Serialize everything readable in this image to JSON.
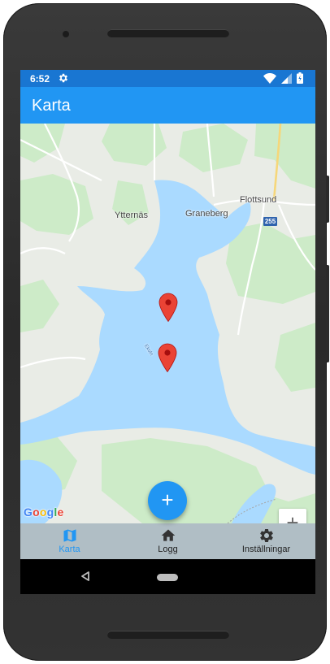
{
  "status_bar": {
    "time": "6:52",
    "icons": [
      "settings-icon",
      "wifi-icon",
      "signal-icon",
      "battery-icon"
    ]
  },
  "app_bar": {
    "title": "Karta"
  },
  "map": {
    "labels": [
      "Ytternäs",
      "Graneberg",
      "Flottsund"
    ],
    "road_shield": "255",
    "lake_label": "Ekoln",
    "attribution": "Google",
    "markers": [
      "location-pin-1",
      "location-pin-2"
    ],
    "zoom_in": "+",
    "zoom_out": "−",
    "colors": {
      "water": "#aadaff",
      "land": "#e9ece6",
      "park": "#cdebc8",
      "marker": "#ea4335"
    }
  },
  "fab": {
    "label": "+"
  },
  "bottom_nav": {
    "items": [
      {
        "label": "Karta",
        "icon": "map-icon",
        "active": true
      },
      {
        "label": "Logg",
        "icon": "home-icon",
        "active": false
      },
      {
        "label": "Inställningar",
        "icon": "gear-icon",
        "active": false
      }
    ]
  },
  "theme": {
    "primary": "#2196f3",
    "status": "#1976d2",
    "nav_bg": "#b0bec5"
  }
}
